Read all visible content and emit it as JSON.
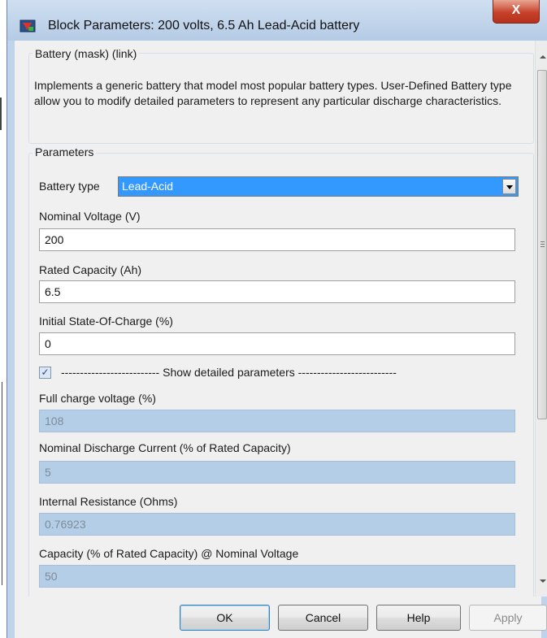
{
  "window": {
    "title": "Block Parameters: 200 volts, 6.5 Ah Lead-Acid battery",
    "close_glyph": "X",
    "app_icon": "simulink-block-icon"
  },
  "mask_group": {
    "label": "Battery (mask) (link)",
    "description": "Implements a generic battery that model most popular battery types. User-Defined Battery type allow you to modify detailed parameters  to represent any particular discharge characteristics."
  },
  "parameters_group": {
    "label": "Parameters",
    "battery_type": {
      "label": "Battery type",
      "value": "Lead-Acid"
    },
    "nominal_voltage": {
      "label": "Nominal Voltage (V)",
      "value": "200"
    },
    "rated_capacity": {
      "label": "Rated Capacity (Ah)",
      "value": "6.5"
    },
    "initial_soc": {
      "label": "Initial State-Of-Charge (%)",
      "value": "0"
    },
    "show_detailed": {
      "checked": true,
      "check_glyph": "✓",
      "label": "-------------------------- Show detailed parameters --------------------------"
    },
    "full_charge_voltage": {
      "label": "Full charge voltage (%)",
      "value": "108"
    },
    "nominal_discharge_current": {
      "label": "Nominal Discharge Current (% of Rated Capacity)",
      "value": "5"
    },
    "internal_resistance": {
      "label": "Internal Resistance (Ohms)",
      "value": "0.76923"
    },
    "capacity_at_nominal_voltage": {
      "label": "Capacity (% of Rated Capacity) @ Nominal Voltage",
      "value": "50"
    }
  },
  "buttons": {
    "ok": "OK",
    "cancel": "Cancel",
    "help": "Help",
    "apply": "Apply"
  },
  "colors": {
    "title_bar": "#bfd3ea",
    "close_button": "#c7412a",
    "selected_option": "#3399ff",
    "disabled_field": "#b5cee8"
  }
}
